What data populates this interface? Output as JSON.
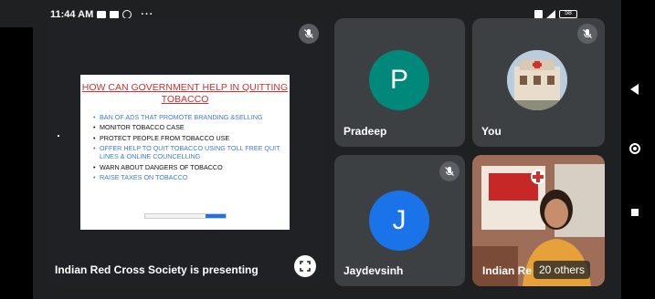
{
  "status_bar": {
    "time": "11:44 AM",
    "more": "···",
    "battery": "58"
  },
  "presentation": {
    "presenter_label": "Indian Red Cross Society is presenting",
    "slide_title": "HOW CAN GOVERNMENT HELP IN QUITTING TOBACCO",
    "bullets": [
      {
        "text": "BAN OF ADS THAT PROMOTE BRANDING &SELLING",
        "color": "#3e7cc8"
      },
      {
        "text": "MONITOR TOBACCO CASE",
        "color": "#111111"
      },
      {
        "text": "PROTECT PEOPLE FROM TOBACCO USE",
        "color": "#111111"
      },
      {
        "text": "OFFER HELP TO QUIT TOBACCO USING TOLL FREE QUIT LINES & ONLINE COUNCELLING",
        "color": "#3e7cc8"
      },
      {
        "text": "WARN ABOUT DANGERS OF TOBACCO",
        "color": "#111111"
      },
      {
        "text": "RAISE TAXES ON TOBACCO",
        "color": "#3e7cc8"
      }
    ]
  },
  "participants": {
    "pradeep": {
      "initial": "P",
      "name": "Pradeep",
      "color": "#00897b"
    },
    "you": {
      "name": "You"
    },
    "jaydevsinh": {
      "initial": "J",
      "name": "Jaydevsinh",
      "color": "#1a73e8"
    },
    "others": {
      "name": "Indian Re",
      "count_label": "20 others"
    }
  }
}
